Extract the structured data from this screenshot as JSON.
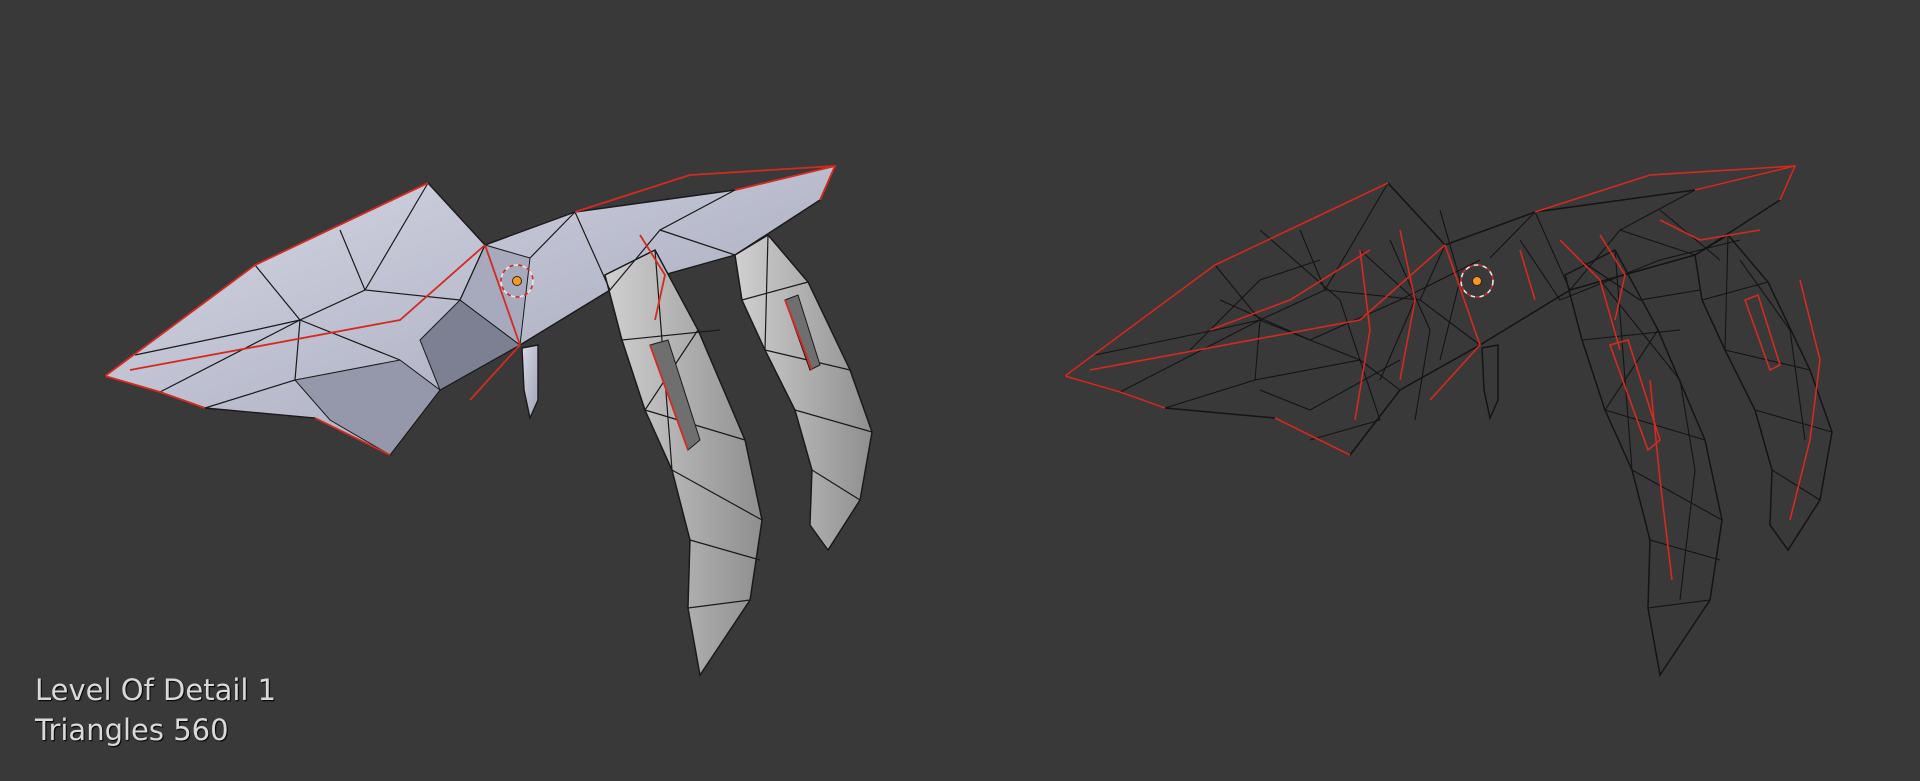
{
  "viewport": {
    "background": "#393939",
    "overlay": {
      "lod_text": "Level Of Detail 1",
      "triangles_text": "Triangles 560"
    }
  },
  "models": [
    {
      "name": "solid-shaded",
      "shading": "solid",
      "fill": "#b9bccc",
      "edge": "#1a1a1a",
      "seam": "#d42a1f"
    },
    {
      "name": "wireframe",
      "shading": "wireframe",
      "edge": "#1a1a1a",
      "seam": "#d42a1f"
    }
  ],
  "icons": [
    "3d-cursor-icon",
    "object-origin-icon"
  ]
}
